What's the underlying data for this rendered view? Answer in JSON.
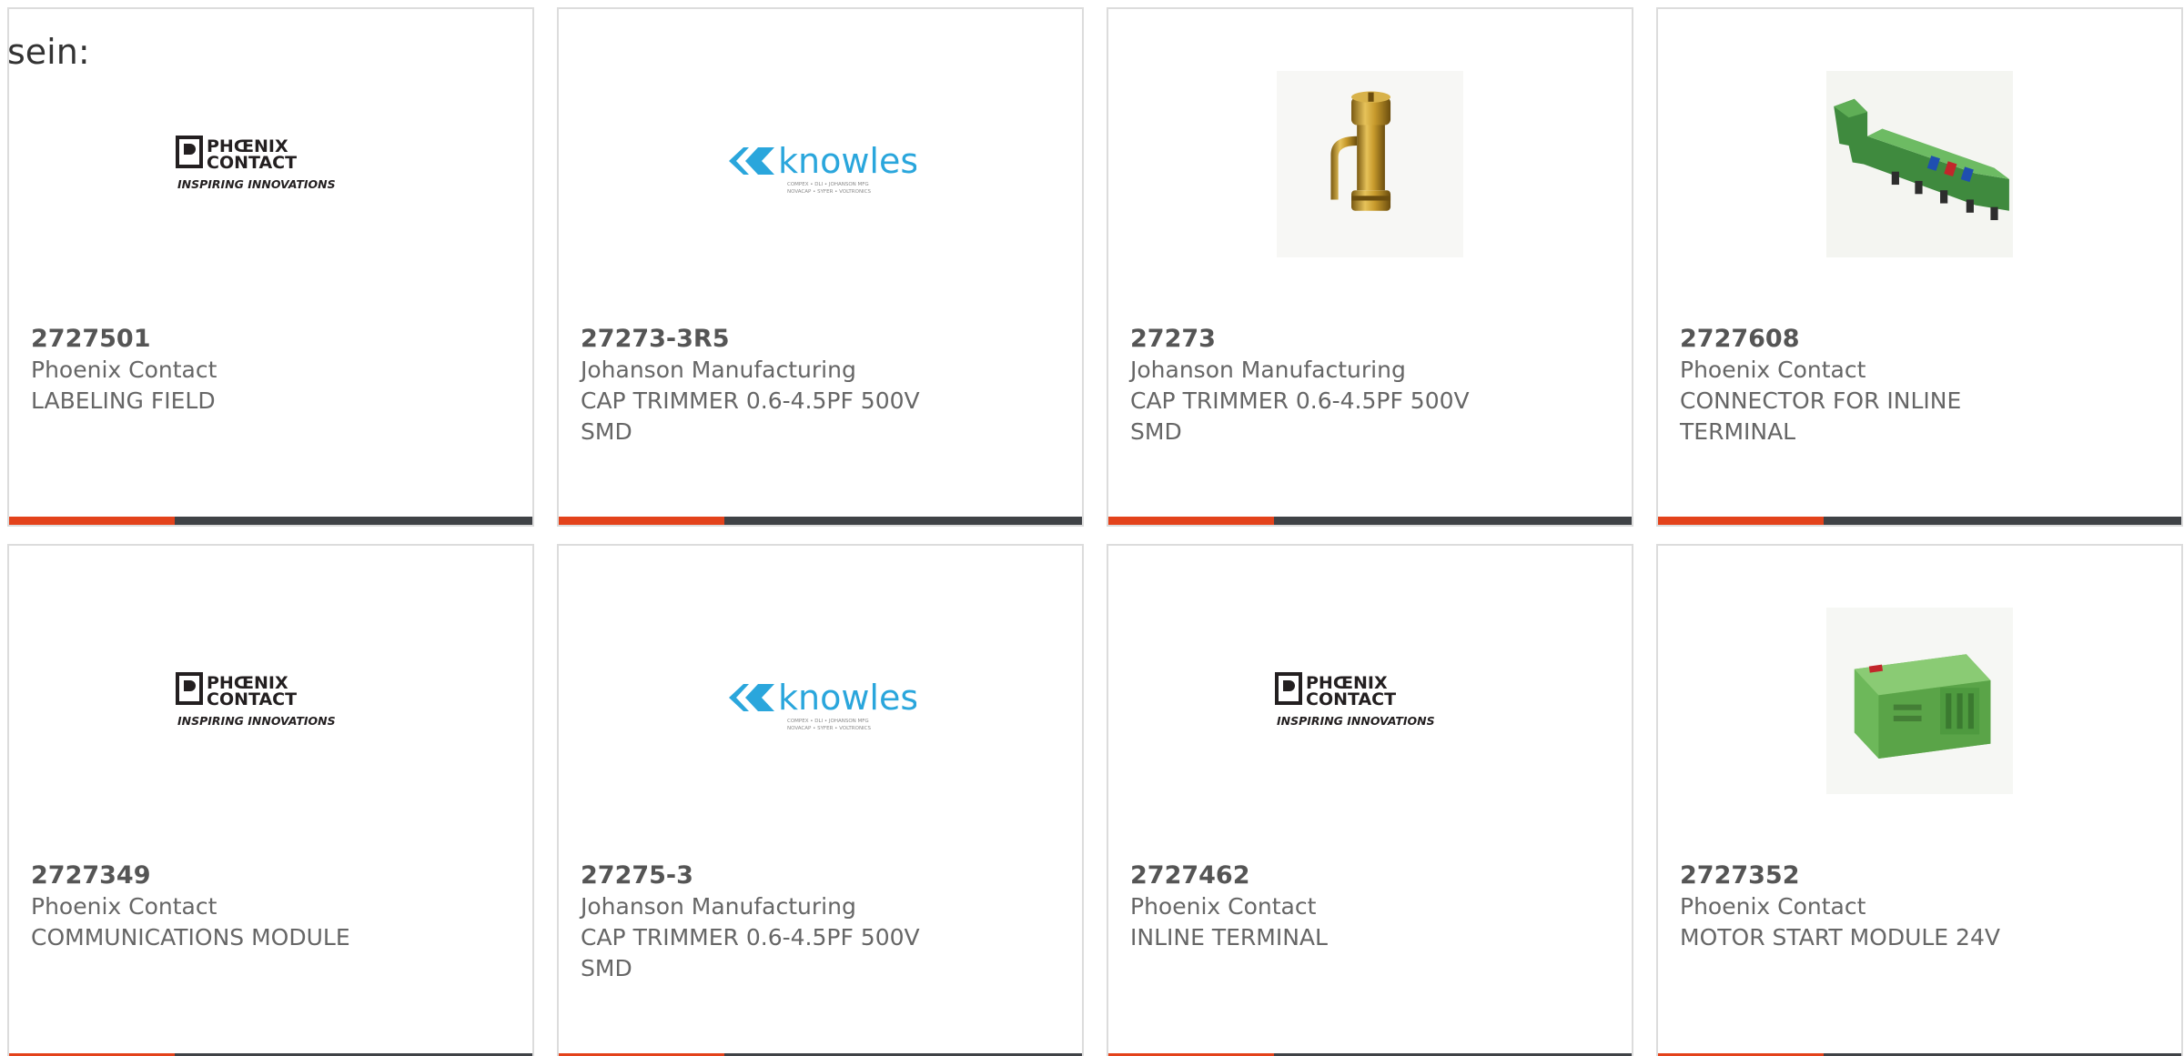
{
  "intro_text": "sein:",
  "colors": {
    "accent": "#e3421b",
    "bar": "#3f4246",
    "phoenix_logo": "#231f20",
    "knowles_logo": "#2aa6dc"
  },
  "logos": {
    "phoenix": {
      "line1": "PHŒNIX",
      "line2": "CONTACT",
      "tagline": "INSPIRING INNOVATIONS"
    },
    "knowles": {
      "name": "knowles",
      "sub1": "COMPEX • DLI • JOHANSON MFG",
      "sub2": "NOVACAP • SYFER • VOLTRONICS"
    }
  },
  "products": [
    {
      "part_number": "2727501",
      "manufacturer": "Phoenix Contact",
      "description": "LABELING FIELD",
      "image": "phoenix-logo"
    },
    {
      "part_number": "27273-3R5",
      "manufacturer": "Johanson Manufacturing",
      "description": "CAP TRIMMER 0.6-4.5PF 500V SMD",
      "image": "knowles-logo"
    },
    {
      "part_number": "27273",
      "manufacturer": "Johanson Manufacturing",
      "description": "CAP TRIMMER 0.6-4.5PF 500V SMD",
      "image": "trimmer-photo"
    },
    {
      "part_number": "2727608",
      "manufacturer": "Phoenix Contact",
      "description": "CONNECTOR FOR INLINE TERMINAL",
      "image": "connector-photo"
    },
    {
      "part_number": "2727349",
      "manufacturer": "Phoenix Contact",
      "description": "COMMUNICATIONS MODULE",
      "image": "phoenix-logo"
    },
    {
      "part_number": "27275-3",
      "manufacturer": "Johanson Manufacturing",
      "description": "CAP TRIMMER 0.6-4.5PF 500V SMD",
      "image": "knowles-logo"
    },
    {
      "part_number": "2727462",
      "manufacturer": "Phoenix Contact",
      "description": "INLINE TERMINAL",
      "image": "phoenix-logo"
    },
    {
      "part_number": "2727352",
      "manufacturer": "Phoenix Contact",
      "description": "MOTOR START MODULE 24V",
      "image": "module-photo"
    }
  ]
}
